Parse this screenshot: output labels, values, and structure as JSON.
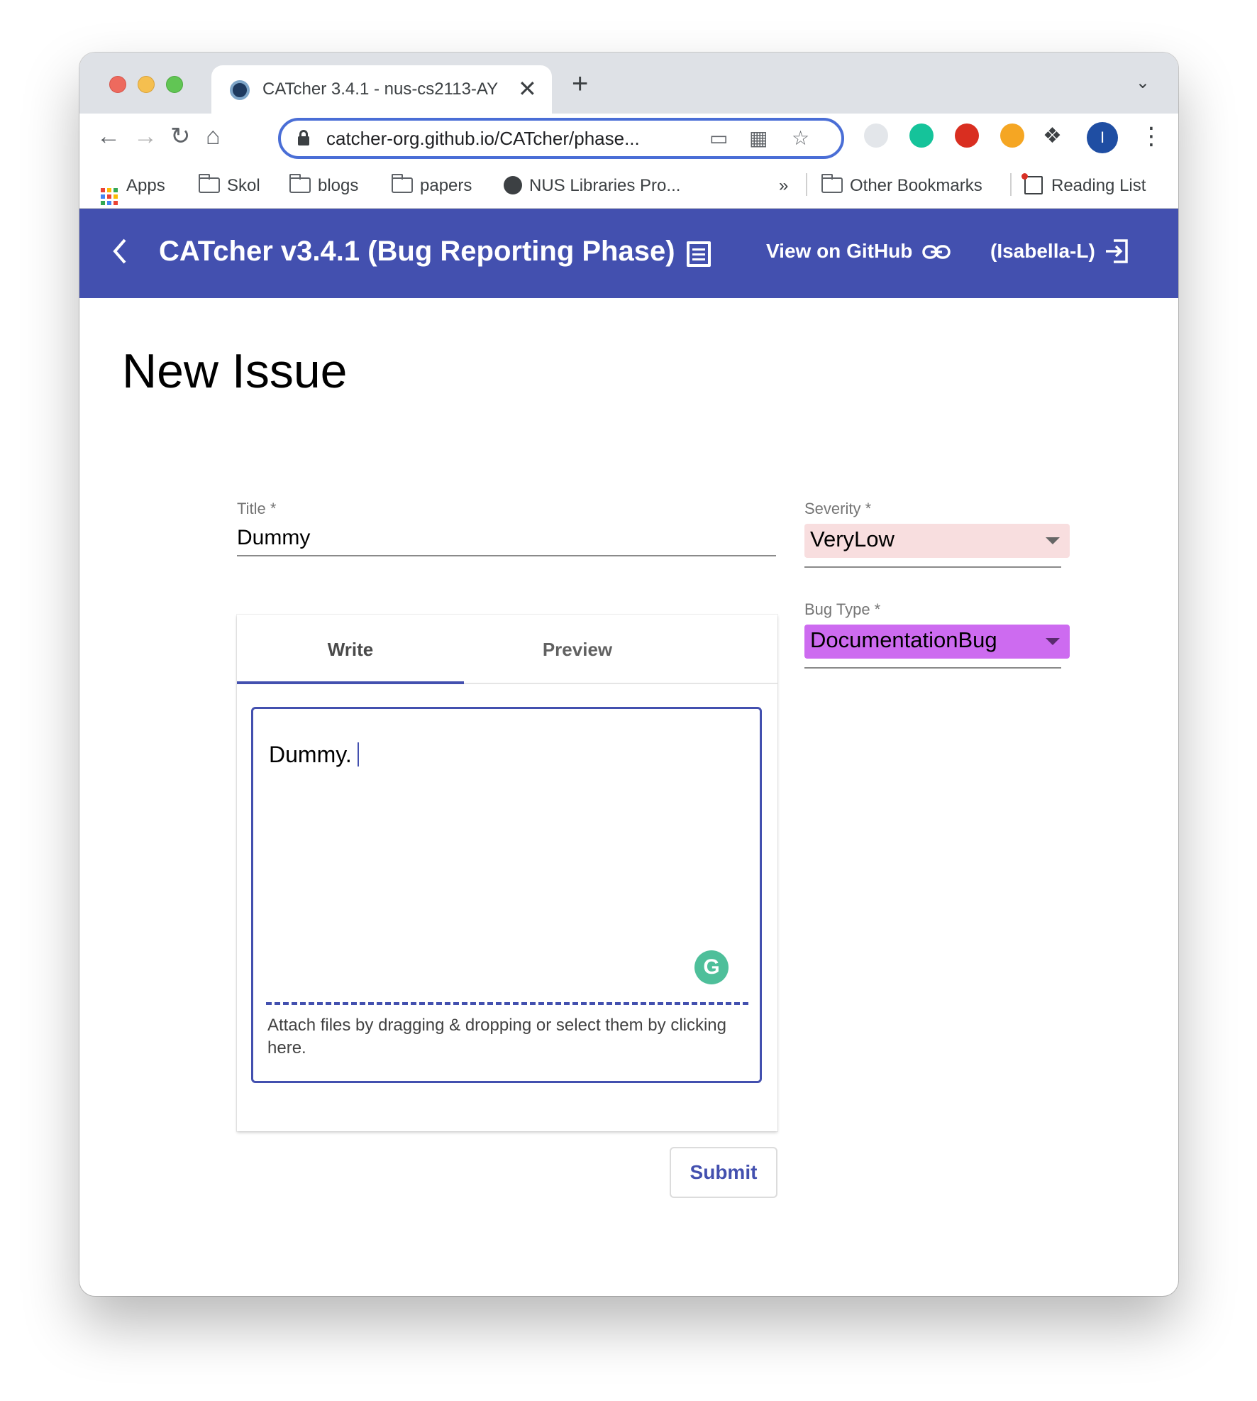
{
  "browser": {
    "tab_title": "CATcher 3.4.1 - nus-cs2113-AY",
    "tab_close": "✕",
    "new_tab": "+",
    "url": "catcher-org.github.io/CATcher/phase...",
    "profile_initial": "I",
    "bookmarks": {
      "apps": "Apps",
      "items": [
        "Skol",
        "blogs",
        "papers",
        "NUS Libraries Pro..."
      ],
      "overflow": "»",
      "other": "Other Bookmarks",
      "reading_list": "Reading List"
    }
  },
  "app": {
    "title": "CATcher v3.4.1  (Bug Reporting Phase)",
    "github_link": "View on GitHub",
    "user": "(Isabella-L)",
    "header_color": "#4350af"
  },
  "page": {
    "heading": "New Issue"
  },
  "form": {
    "title_label": "Title *",
    "title_value": "Dummy",
    "editor_tabs": [
      "Write",
      "Preview"
    ],
    "active_tab": "Write",
    "description_value": "Dummy.",
    "attach_text": "Attach files by dragging & dropping or select them by clicking here.",
    "severity_label": "Severity *",
    "severity_value": "VeryLow",
    "severity_color": "#f8dedf",
    "bug_type_label": "Bug Type *",
    "bug_type_value": "DocumentationBug",
    "bug_type_color": "#cd6bf0",
    "submit_label": "Submit"
  },
  "icons": {
    "grammarly_letter": "G"
  }
}
